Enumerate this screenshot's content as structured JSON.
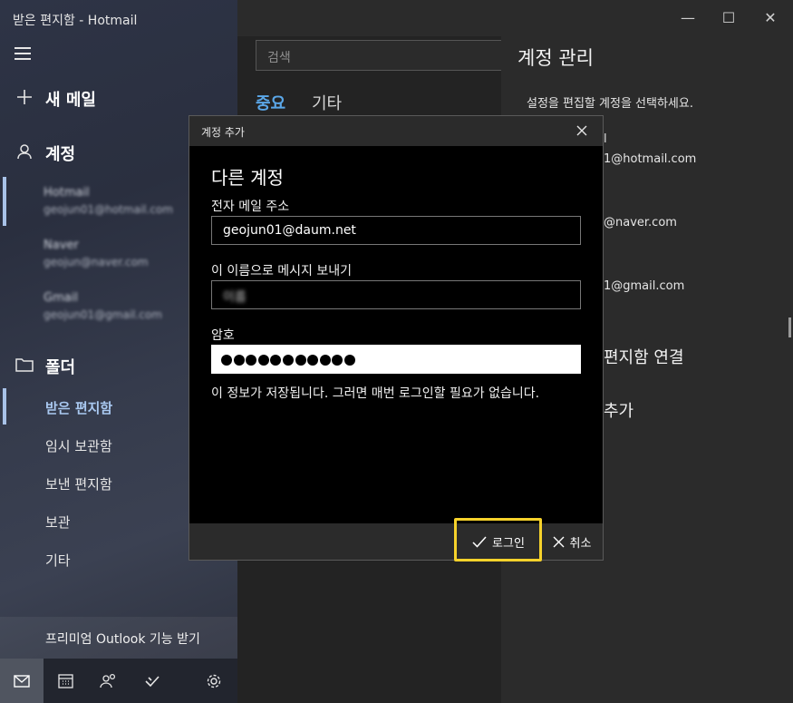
{
  "window": {
    "title": "받은 편지함 - Hotmail",
    "minimize": "—",
    "maximize": "☐",
    "close": "✕"
  },
  "sidebar": {
    "new_mail": "새 메일",
    "accounts_label": "계정",
    "accounts": [
      {
        "name": "Hotmail",
        "email": "geojun01@hotmail.com"
      },
      {
        "name": "Naver",
        "email": "geojun@naver.com"
      },
      {
        "name": "Gmail",
        "email": "geojun01@gmail.com"
      }
    ],
    "folders_label": "폴더",
    "folders": [
      "받은 편지함",
      "임시 보관함",
      "보낸 편지함",
      "보관",
      "기타"
    ],
    "premium": "프리미엄 Outlook 기능 받기"
  },
  "middle": {
    "search_placeholder": "검색",
    "tab_focused": "중요",
    "tab_other": "기타"
  },
  "manage": {
    "title": "계정 관리",
    "subtitle": "설정을 편집할 계정을 선택하세요.",
    "hotmail_fragment": "1@hotmail.com",
    "hotmail_label_fragment": "l",
    "naver_fragment": "@naver.com",
    "gmail_fragment": "1@gmail.com",
    "link_inbox": "편지함 연결",
    "link_add": "추가"
  },
  "dialog": {
    "header": "계정 추가",
    "title": "다른 계정",
    "email_label": "전자 메일 주소",
    "email_value": "geojun01@daum.net",
    "name_label": "이 이름으로 메시지 보내기",
    "name_value": "이름",
    "password_label": "암호",
    "password_length": 11,
    "note": "이 정보가 저장됩니다. 그러면 매번 로그인할 필요가 없습니다.",
    "login": "로그인",
    "cancel": "취소"
  },
  "colors": {
    "accent": "#5ba7e8",
    "highlight": "#f6d22b",
    "active_folder": "#a9c8f0"
  }
}
